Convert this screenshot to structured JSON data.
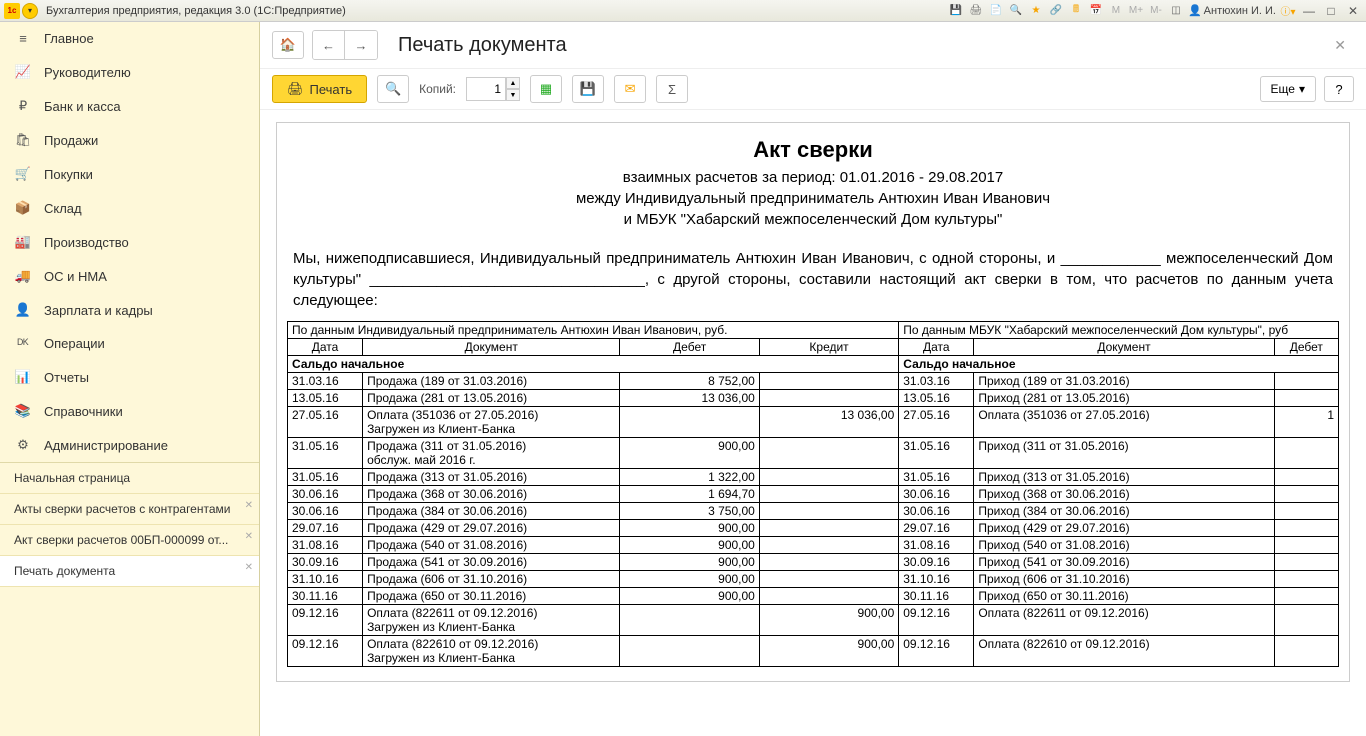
{
  "titlebar": {
    "title": "Бухгалтерия предприятия, редакция 3.0  (1С:Предприятие)",
    "user": "Антюхин И. И."
  },
  "sidebar": {
    "items": [
      {
        "icon": "≡",
        "label": "Главное"
      },
      {
        "icon": "📈",
        "label": "Руководителю"
      },
      {
        "icon": "₽",
        "label": "Банк и касса"
      },
      {
        "icon": "🛍",
        "label": "Продажи"
      },
      {
        "icon": "🛒",
        "label": "Покупки"
      },
      {
        "icon": "📦",
        "label": "Склад"
      },
      {
        "icon": "🏭",
        "label": "Производство"
      },
      {
        "icon": "🚚",
        "label": "ОС и НМА"
      },
      {
        "icon": "👤",
        "label": "Зарплата и кадры"
      },
      {
        "icon": "ᴰᴷ",
        "label": "Операции"
      },
      {
        "icon": "📊",
        "label": "Отчеты"
      },
      {
        "icon": "📚",
        "label": "Справочники"
      },
      {
        "icon": "⚙",
        "label": "Администрирование"
      }
    ],
    "tabs": [
      {
        "label": "Начальная страница"
      },
      {
        "label": "Акты сверки расчетов с контрагентами"
      },
      {
        "label": "Акт сверки расчетов 00БП-000099 от..."
      },
      {
        "label": "Печать документа",
        "active": true
      }
    ]
  },
  "toolbar": {
    "page_title": "Печать документа",
    "print_label": "Печать",
    "copies_label": "Копий:",
    "copies_value": "1",
    "more_label": "Еще",
    "help_label": "?"
  },
  "document": {
    "title": "Акт сверки",
    "sub1": "взаимных расчетов за период: 01.01.2016 - 29.08.2017",
    "sub2": "между Индивидуальный предприниматель Антюхин Иван Иванович",
    "sub3": "и МБУК \"Хабарский межпоселенческий Дом культуры\"",
    "intro": "Мы, нижеподписавшиеся, Индивидуальный предприниматель Антюхин Иван Иванович, с одной стороны, и ____________ межпоселенческий Дом культуры\" _________________________________, с другой стороны, составили настоящий акт сверки в том, что расчетов по данным учета следующее:",
    "header_left": "По данным Индивидуальный предприниматель Антюхин Иван Иванович, руб.",
    "header_right": "По данным МБУК \"Хабарский межпоселенческий Дом культуры\", руб",
    "cols": {
      "date": "Дата",
      "doc": "Документ",
      "debit": "Дебет",
      "credit": "Кредит"
    },
    "saldo": "Сальдо начальное",
    "rows": [
      {
        "d": "31.03.16",
        "doc": "Продажа (189 от 31.03.2016)",
        "deb": "8 752,00",
        "cre": "",
        "d2": "31.03.16",
        "doc2": "Приход (189 от 31.03.2016)",
        "deb2": ""
      },
      {
        "d": "13.05.16",
        "doc": "Продажа (281 от 13.05.2016)",
        "deb": "13 036,00",
        "cre": "",
        "d2": "13.05.16",
        "doc2": "Приход (281 от 13.05.2016)",
        "deb2": ""
      },
      {
        "d": "27.05.16",
        "doc": "Оплата (351036 от 27.05.2016)\nЗагружен из Клиент-Банка",
        "deb": "",
        "cre": "13 036,00",
        "d2": "27.05.16",
        "doc2": "Оплата (351036 от 27.05.2016)",
        "deb2": "1"
      },
      {
        "d": "31.05.16",
        "doc": "Продажа (311 от 31.05.2016)\nобслуж. май 2016 г.",
        "deb": "900,00",
        "cre": "",
        "d2": "31.05.16",
        "doc2": "Приход (311 от 31.05.2016)",
        "deb2": ""
      },
      {
        "d": "31.05.16",
        "doc": "Продажа (313 от 31.05.2016)",
        "deb": "1 322,00",
        "cre": "",
        "d2": "31.05.16",
        "doc2": "Приход (313 от 31.05.2016)",
        "deb2": ""
      },
      {
        "d": "30.06.16",
        "doc": "Продажа (368 от 30.06.2016)",
        "deb": "1 694,70",
        "cre": "",
        "d2": "30.06.16",
        "doc2": "Приход (368 от 30.06.2016)",
        "deb2": ""
      },
      {
        "d": "30.06.16",
        "doc": "Продажа (384 от 30.06.2016)",
        "deb": "3 750,00",
        "cre": "",
        "d2": "30.06.16",
        "doc2": "Приход (384 от 30.06.2016)",
        "deb2": ""
      },
      {
        "d": "29.07.16",
        "doc": "Продажа (429 от 29.07.2016)",
        "deb": "900,00",
        "cre": "",
        "d2": "29.07.16",
        "doc2": "Приход (429 от 29.07.2016)",
        "deb2": ""
      },
      {
        "d": "31.08.16",
        "doc": "Продажа (540 от 31.08.2016)",
        "deb": "900,00",
        "cre": "",
        "d2": "31.08.16",
        "doc2": "Приход (540 от 31.08.2016)",
        "deb2": ""
      },
      {
        "d": "30.09.16",
        "doc": "Продажа (541 от 30.09.2016)",
        "deb": "900,00",
        "cre": "",
        "d2": "30.09.16",
        "doc2": "Приход (541 от 30.09.2016)",
        "deb2": ""
      },
      {
        "d": "31.10.16",
        "doc": "Продажа (606 от 31.10.2016)",
        "deb": "900,00",
        "cre": "",
        "d2": "31.10.16",
        "doc2": "Приход (606 от 31.10.2016)",
        "deb2": ""
      },
      {
        "d": "30.11.16",
        "doc": "Продажа (650 от 30.11.2016)",
        "deb": "900,00",
        "cre": "",
        "d2": "30.11.16",
        "doc2": "Приход (650 от 30.11.2016)",
        "deb2": ""
      },
      {
        "d": "09.12.16",
        "doc": "Оплата (822611 от 09.12.2016)\nЗагружен из Клиент-Банка",
        "deb": "",
        "cre": "900,00",
        "d2": "09.12.16",
        "doc2": "Оплата (822611 от 09.12.2016)",
        "deb2": ""
      },
      {
        "d": "09.12.16",
        "doc": "Оплата (822610 от 09.12.2016)\nЗагружен из Клиент-Банка",
        "deb": "",
        "cre": "900,00",
        "d2": "09.12.16",
        "doc2": "Оплата (822610 от 09.12.2016)",
        "deb2": ""
      }
    ]
  }
}
